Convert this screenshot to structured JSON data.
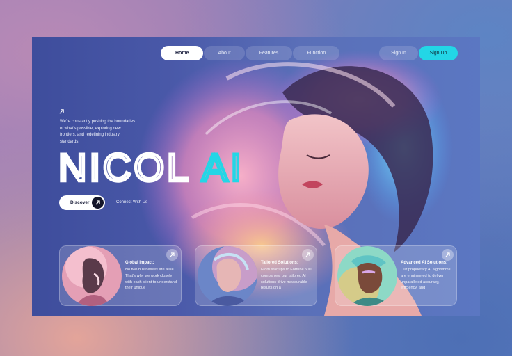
{
  "nav": {
    "items": [
      {
        "label": "Home",
        "active": true
      },
      {
        "label": "About",
        "active": false
      },
      {
        "label": "Features",
        "active": false
      },
      {
        "label": "Function",
        "active": false
      }
    ],
    "sign_in": "Sign In",
    "sign_up": "Sign Up"
  },
  "hero": {
    "intro": "We're constantly pushing the boundaries of what's possible, exploring new frontiers, and redefining industry standards.",
    "logo_text": "NICOLAI",
    "discover_label": "Discover",
    "connect_label": "Connect With Us"
  },
  "cards": [
    {
      "title": "Global Impact:",
      "description": "No two businesses are alike. That's why we work closely with each client to understand their unique"
    },
    {
      "title": "Tailored Solutions:",
      "description": "From startups to Fortune 500 companies, our tailored AI solutions drive measurable results on a"
    },
    {
      "title": "Advanced AI Solutions:",
      "description": "Our proprietary AI algorithms are engineered to deliver unparalleled accuracy, efficiency, and"
    }
  ],
  "colors": {
    "accent": "#23d6e6",
    "frame_background": "#4958a8",
    "logo_text": "#ffffff",
    "logo_accent": "#23d6e6"
  },
  "icons": {
    "arrow": "arrow-up-right-icon"
  }
}
